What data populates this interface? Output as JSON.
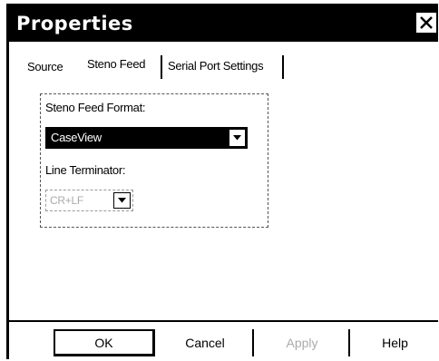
{
  "window": {
    "title": "Properties"
  },
  "tabs": [
    {
      "label": "Source"
    },
    {
      "label": "Steno Feed"
    },
    {
      "label": "Serial Port Settings"
    }
  ],
  "form": {
    "format_label": "Steno Feed Format:",
    "format_value": "CaseView",
    "terminator_label": "Line Terminator:",
    "terminator_value": "CR+LF"
  },
  "buttons": {
    "ok": "OK",
    "cancel": "Cancel",
    "apply": "Apply",
    "help": "Help"
  },
  "colors": {
    "titlebar": "#000000",
    "disabled_text": "#aaaaaa"
  }
}
